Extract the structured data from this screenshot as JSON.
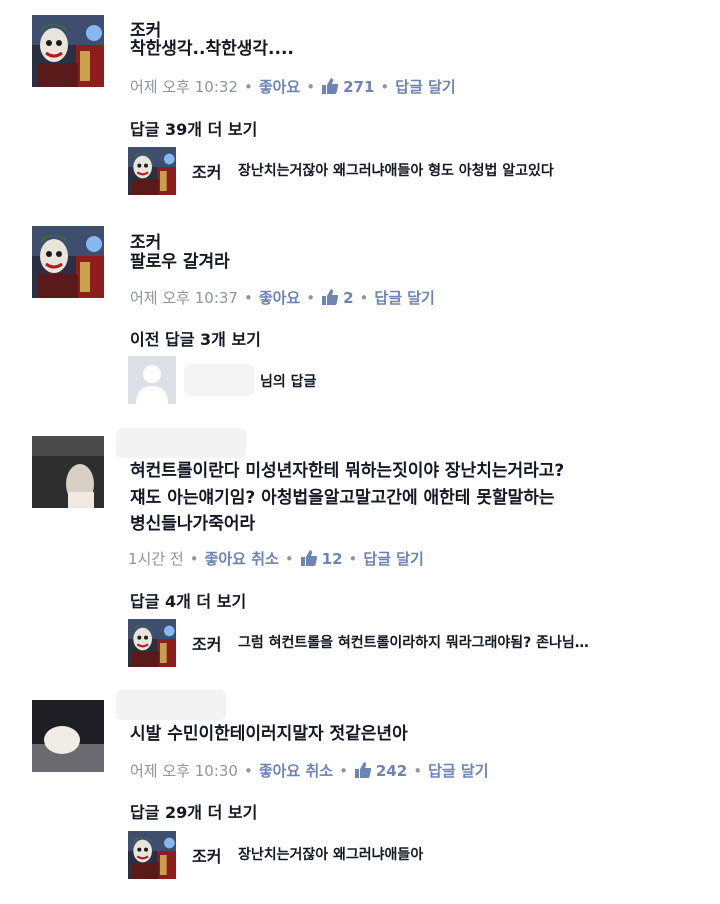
{
  "comments": [
    {
      "name": "조커",
      "text": "착한생각..착한생각....",
      "time": "어제 오후 10:32",
      "like_label": "좋아요",
      "likes": "271",
      "reply_label": "답글 달기",
      "more_replies": "답글 39개 더 보기",
      "reply": {
        "name": "조커",
        "text": "장난치는거잖아 왜그러냐애들아 형도 아청법 알고있다"
      }
    },
    {
      "name": "조커",
      "text": "팔로우 갈겨라",
      "time": "어제 오후 10:37",
      "like_label": "좋아요",
      "likes": "2",
      "reply_label": "답글 달기",
      "more_replies": "이전 답글 3개 보기",
      "reply": {
        "text": "님의 답글"
      }
    },
    {
      "text_line1": "혀컨트롤이란다 미성년자한테 뭐하는짓이야 장난치는거라고?",
      "text_line2": "쟤도 아는얘기임? 아청법을알고말고간에 애한테 못할말하는",
      "text_line3": "병신들나가죽어라",
      "time": "1시간 전",
      "like_label": "좋아요 취소",
      "likes": "12",
      "reply_label": "답글 달기",
      "more_replies": "답글 4개 더 보기",
      "reply": {
        "name": "조커",
        "text": "그럼 혀컨트롤을 혀컨트롤이라하지 뭐라그래야됨? 존나님…"
      }
    },
    {
      "text": "시발 수민이한테이러지말자 젓같은년아",
      "time": "어제 오후 10:30",
      "like_label": "좋아요 취소",
      "likes": "242",
      "reply_label": "답글 달기",
      "more_replies": "답글 29개 더 보기",
      "reply": {
        "name": "조커",
        "text": "장난치는거잖아 왜그러냐애들아"
      }
    }
  ],
  "colors": {
    "link": "#6d84b4",
    "meta": "#90949c",
    "text": "#141823"
  },
  "icons": {
    "like": "thumbs-up-icon"
  }
}
